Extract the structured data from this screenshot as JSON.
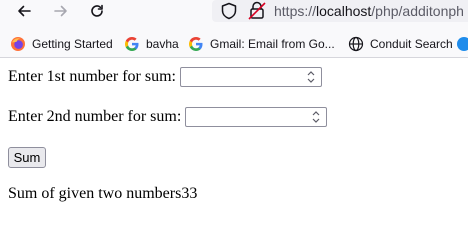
{
  "browser": {
    "url_prefix": "https://",
    "url_host": "localhost",
    "url_path": "/php/additonph",
    "bookmarks": [
      {
        "label": "Getting Started",
        "icon": "firefox-icon"
      },
      {
        "label": "bavha",
        "icon": "google-icon"
      },
      {
        "label": "Gmail: Email from Go...",
        "icon": "google-icon"
      },
      {
        "label": "Conduit Search",
        "icon": "globe-icon"
      },
      {
        "label": "",
        "icon": "partial-blue-icon"
      }
    ]
  },
  "form": {
    "first_label": "Enter 1st number for sum:",
    "first_value": "",
    "second_label": "Enter 2nd number for sum:",
    "second_value": "",
    "submit_label": "Sum"
  },
  "result": {
    "text": "Sum of given two numbers33"
  },
  "colors": {
    "toolbar_bg": "#f9f9fb",
    "urlbar_bg": "#f0f0f4",
    "button_bg": "#e9e9ed",
    "google_blue": "#4285f4",
    "firefox_orange": "#ff7139"
  }
}
